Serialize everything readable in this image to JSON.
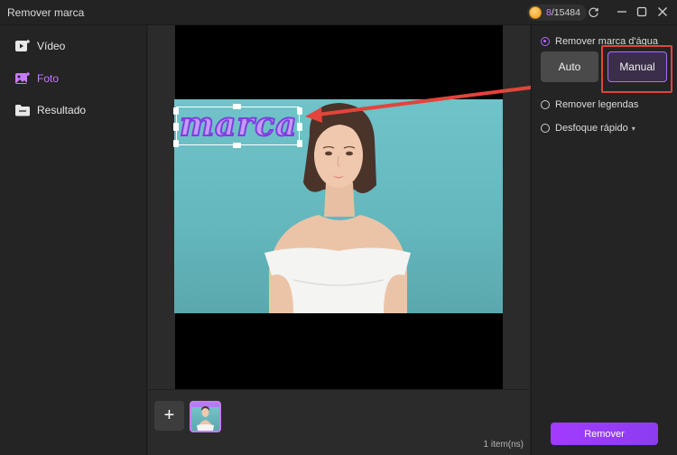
{
  "window": {
    "title": "Remover marca",
    "credits_used": "8",
    "credits_total": "/15484"
  },
  "sidebar": {
    "items": [
      {
        "label": "Vídeo",
        "icon": "video-add-icon",
        "active": false
      },
      {
        "label": "Foto",
        "icon": "photo-add-icon",
        "active": true
      },
      {
        "label": "Resultado",
        "icon": "folder-icon",
        "active": false
      }
    ]
  },
  "canvas": {
    "watermark_text": "marca"
  },
  "bottom": {
    "add_label": "+",
    "items_count": "1 item(ns)"
  },
  "right_panel": {
    "options": {
      "remove_watermark": "Remover marca d'água",
      "remove_subtitles": "Remover legendas",
      "quick_blur": "Desfoque rápido"
    },
    "modes": {
      "auto": "Auto",
      "manual": "Manual",
      "selected": "Manual"
    },
    "remove_button": "Remover"
  },
  "colors": {
    "accent": "#b06bff",
    "highlight_red": "#e3443b",
    "photo_background": "#6fc3c9"
  }
}
